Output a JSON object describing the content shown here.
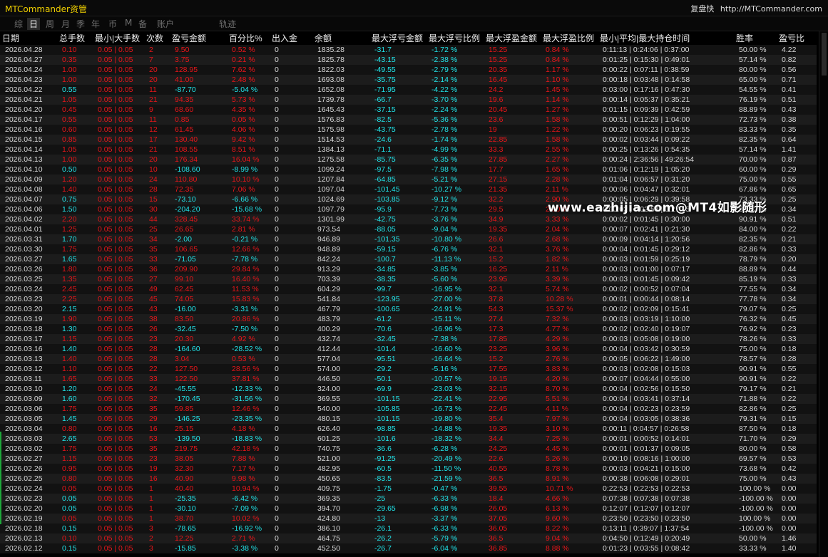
{
  "app": {
    "title": "MTCommander资管",
    "replay_label": "复盘快",
    "url": "http://MTCommander.com"
  },
  "nav": [
    "综",
    "日",
    "周",
    "月",
    "季",
    "年",
    "币",
    "M",
    "备",
    "账户",
    "轨迹"
  ],
  "nav_selected": 1,
  "columns": [
    "日期",
    "总手数",
    "最小|大手数",
    "次数",
    "盈亏金额",
    "百分比%",
    "出入金",
    "余额",
    "最大浮亏金额",
    "最大浮亏比例",
    "最大浮盈金额",
    "最大浮盈比例",
    "最小|平均|最大持仓时间",
    "胜率",
    "盈亏比"
  ],
  "watermark": "www.eazhijia.com@MT4如影随形",
  "rows": [
    [
      "2026.04.28",
      "0.10",
      "0.05 | 0.05",
      "2",
      "9.50",
      "0.52 %",
      "0",
      "1835.28",
      "-31.7",
      "-1.72 %",
      "15.25",
      "0.84 %",
      "0:11:13 | 0:24:06 | 0:37:00",
      "50.00 %",
      "4.22"
    ],
    [
      "2026.04.27",
      "0.35",
      "0.05 | 0.05",
      "7",
      "3.75",
      "0.21 %",
      "0",
      "1825.78",
      "-43.15",
      "-2.38 %",
      "15.25",
      "0.84 %",
      "0:01:25 | 0:15:30 | 0:49:01",
      "57.14 %",
      "0.82"
    ],
    [
      "2026.04.24",
      "1.00",
      "0.05 | 0.05",
      "20",
      "128.95",
      "7.62 %",
      "0",
      "1822.03",
      "-49.55",
      "-2.79 %",
      "20.35",
      "1.17 %",
      "0:00:22 | 0:07:11 | 0:38:59",
      "80.00 %",
      "0.56"
    ],
    [
      "2026.04.23",
      "1.00",
      "0.05 | 0.05",
      "20",
      "41.00",
      "2.48 %",
      "0",
      "1693.08",
      "-35.75",
      "-2.14 %",
      "16.45",
      "1.10 %",
      "0:00:18 | 0:03:48 | 0:14:58",
      "65.00 %",
      "0.71"
    ],
    [
      "2026.04.22",
      "0.55",
      "0.05 | 0.05",
      "11",
      "-87.70",
      "-5.04 %",
      "0",
      "1652.08",
      "-71.95",
      "-4.22 %",
      "24.2",
      "1.45 %",
      "0:03:00 | 0:17:16 | 0:47:30",
      "54.55 %",
      "0.41"
    ],
    [
      "2026.04.21",
      "1.05",
      "0.05 | 0.05",
      "21",
      "94.35",
      "5.73 %",
      "0",
      "1739.78",
      "-66.7",
      "-3.70 %",
      "19.6",
      "1.14 %",
      "0:00:14 | 0:05:37 | 0:35:21",
      "76.19 %",
      "0.51"
    ],
    [
      "2026.04.20",
      "0.45",
      "0.05 | 0.05",
      "9",
      "68.60",
      "4.35 %",
      "0",
      "1645.43",
      "-37.15",
      "-2.24 %",
      "20.45",
      "1.27 %",
      "0:01:15 | 0:09:39 | 0:42:59",
      "88.89 %",
      "0.43"
    ],
    [
      "2026.04.17",
      "0.55",
      "0.05 | 0.05",
      "11",
      "0.85",
      "0.05 %",
      "0",
      "1576.83",
      "-82.5",
      "-5.36 %",
      "23.6",
      "1.58 %",
      "0:00:51 | 0:12:29 | 1:04:00",
      "72.73 %",
      "0.38"
    ],
    [
      "2026.04.16",
      "0.60",
      "0.05 | 0.05",
      "12",
      "61.45",
      "4.06 %",
      "0",
      "1575.98",
      "-43.75",
      "-2.78 %",
      "19",
      "1.22 %",
      "0:00:20 | 0:06:23 | 0:19:55",
      "83.33 %",
      "0.35"
    ],
    [
      "2026.04.15",
      "0.85",
      "0.05 | 0.05",
      "17",
      "130.40",
      "9.42 %",
      "0",
      "1514.53",
      "-24.6",
      "-1.74 %",
      "22.85",
      "1.58 %",
      "0:00:02 | 0:03:44 | 0:09:22",
      "82.35 %",
      "0.64"
    ],
    [
      "2026.04.14",
      "1.05",
      "0.05 | 0.05",
      "21",
      "108.55",
      "8.51 %",
      "0",
      "1384.13",
      "-71.1",
      "-4.99 %",
      "33.3",
      "2.55 %",
      "0:00:25 | 0:13:26 | 0:54:35",
      "57.14 %",
      "1.41"
    ],
    [
      "2026.04.13",
      "1.00",
      "0.05 | 0.05",
      "20",
      "176.34",
      "16.04 %",
      "0",
      "1275.58",
      "-85.75",
      "-6.35 %",
      "27.85",
      "2.27 %",
      "0:00:24 | 2:36:56 | 49:26:54",
      "70.00 %",
      "0.87"
    ],
    [
      "2026.04.10",
      "0.50",
      "0.05 | 0.05",
      "10",
      "-108.60",
      "-8.99 %",
      "0",
      "1099.24",
      "-97.5",
      "-7.98 %",
      "17.7",
      "1.65 %",
      "0:01:06 | 0:12:19 | 1:05:20",
      "60.00 %",
      "0.29"
    ],
    [
      "2026.04.09",
      "1.20",
      "0.05 | 0.05",
      "24",
      "110.80",
      "10.10 %",
      "0",
      "1207.84",
      "-64.85",
      "-5.21 %",
      "27.15",
      "2.28 %",
      "0:01:04 | 0:06:57 | 0:31:20",
      "75.00 %",
      "0.55"
    ],
    [
      "2026.04.08",
      "1.40",
      "0.05 | 0.05",
      "28",
      "72.35",
      "7.06 %",
      "0",
      "1097.04",
      "-101.45",
      "-10.27 %",
      "21.35",
      "2.11 %",
      "0:00:06 | 0:04:47 | 0:32:01",
      "67.86 %",
      "0.65"
    ],
    [
      "2026.04.07",
      "0.75",
      "0.05 | 0.05",
      "15",
      "-73.10",
      "-6.66 %",
      "0",
      "1024.69",
      "-103.85",
      "-9.12 %",
      "32.2",
      "2.90 %",
      "0:00:05 | 0:06:29 | 0:39:58",
      "73.33 %",
      "0.25"
    ],
    [
      "2026.04.06",
      "1.50",
      "0.05 | 0.05",
      "30",
      "-204.20",
      "-15.68 %",
      "0",
      "1097.79",
      "-95.9",
      "-7.73 %",
      "29.5",
      "2.60 %",
      "0:00:02 | 0:02:53 | 0:27:15",
      "83.33 %",
      "0.34"
    ],
    [
      "2026.04.02",
      "2.20",
      "0.05 | 0.05",
      "44",
      "328.45",
      "33.74 %",
      "0",
      "1301.99",
      "-42.75",
      "-3.76 %",
      "34.9",
      "3.33 %",
      "0:00:02 | 0:01:45 | 0:30:00",
      "90.91 %",
      "0.51"
    ],
    [
      "2026.04.01",
      "1.25",
      "0.05 | 0.05",
      "25",
      "26.65",
      "2.81 %",
      "0",
      "973.54",
      "-88.05",
      "-9.04 %",
      "19.35",
      "2.04 %",
      "0:00:07 | 0:02:41 | 0:21:30",
      "84.00 %",
      "0.22"
    ],
    [
      "2026.03.31",
      "1.70",
      "0.05 | 0.05",
      "34",
      "-2.00",
      "-0.21 %",
      "0",
      "946.89",
      "-101.35",
      "-10.80 %",
      "26.6",
      "2.68 %",
      "0:00:09 | 0:04:14 | 1:20:56",
      "82.35 %",
      "0.21"
    ],
    [
      "2026.03.30",
      "1.75",
      "0.05 | 0.05",
      "35",
      "106.65",
      "12.66 %",
      "0",
      "948.89",
      "-59.15",
      "-6.76 %",
      "32.1",
      "3.76 %",
      "0:00:04 | 0:01:45 | 0:29:12",
      "82.86 %",
      "0.33"
    ],
    [
      "2026.03.27",
      "1.65",
      "0.05 | 0.05",
      "33",
      "-71.05",
      "-7.78 %",
      "0",
      "842.24",
      "-100.7",
      "-11.13 %",
      "15.2",
      "1.82 %",
      "0:00:03 | 0:01:59 | 0:25:19",
      "78.79 %",
      "0.20"
    ],
    [
      "2026.03.26",
      "1.80",
      "0.05 | 0.05",
      "36",
      "209.90",
      "29.84 %",
      "0",
      "913.29",
      "-34.85",
      "-3.85 %",
      "16.25",
      "2.11 %",
      "0:00:03 | 0:01:00 | 0:07:17",
      "88.89 %",
      "0.44"
    ],
    [
      "2026.03.25",
      "1.35",
      "0.05 | 0.05",
      "27",
      "99.10",
      "16.40 %",
      "0",
      "703.39",
      "-38.35",
      "-5.60 %",
      "23.95",
      "3.39 %",
      "0:00:03 | 0:01:45 | 0:09:42",
      "85.19 %",
      "0.33"
    ],
    [
      "2026.03.24",
      "2.45",
      "0.05 | 0.05",
      "49",
      "62.45",
      "11.53 %",
      "0",
      "604.29",
      "-99.7",
      "-16.95 %",
      "32.1",
      "5.74 %",
      "0:00:02 | 0:00:52 | 0:07:04",
      "77.55 %",
      "0.34"
    ],
    [
      "2026.03.23",
      "2.25",
      "0.05 | 0.05",
      "45",
      "74.05",
      "15.83 %",
      "0",
      "541.84",
      "-123.95",
      "-27.00 %",
      "37.8",
      "10.28 %",
      "0:00:01 | 0:00:44 | 0:08:14",
      "77.78 %",
      "0.34"
    ],
    [
      "2026.03.20",
      "2.15",
      "0.05 | 0.05",
      "43",
      "-16.00",
      "-3.31 %",
      "0",
      "467.79",
      "-100.65",
      "-24.91 %",
      "54.3",
      "15.37 %",
      "0:00:02 | 0:02:09 | 0:15:41",
      "79.07 %",
      "0.25"
    ],
    [
      "2026.03.19",
      "1.90",
      "0.05 | 0.05",
      "38",
      "83.50",
      "20.86 %",
      "0",
      "483.79",
      "-61.2",
      "-15.11 %",
      "27.4",
      "7.32 %",
      "0:00:03 | 0:03:19 | 1:10:00",
      "76.32 %",
      "0.45"
    ],
    [
      "2026.03.18",
      "1.30",
      "0.05 | 0.05",
      "26",
      "-32.45",
      "-7.50 %",
      "0",
      "400.29",
      "-70.6",
      "-16.96 %",
      "17.3",
      "4.77 %",
      "0:00:02 | 0:02:40 | 0:19:07",
      "76.92 %",
      "0.23"
    ],
    [
      "2026.03.17",
      "1.15",
      "0.05 | 0.05",
      "23",
      "20.30",
      "4.92 %",
      "0",
      "432.74",
      "-32.45",
      "-7.38 %",
      "17.85",
      "4.29 %",
      "0:00:03 | 0:05:08 | 0:19:00",
      "78.26 %",
      "0.33"
    ],
    [
      "2026.03.16",
      "1.40",
      "0.05 | 0.05",
      "28",
      "-164.60",
      "-28.52 %",
      "0",
      "412.44",
      "-101.4",
      "-16.60 %",
      "23.25",
      "3.96 %",
      "0:00:04 | 0:03:42 | 0:30:59",
      "75.00 %",
      "0.18"
    ],
    [
      "2026.03.13",
      "1.40",
      "0.05 | 0.05",
      "28",
      "3.04",
      "0.53 %",
      "0",
      "577.04",
      "-95.51",
      "-16.64 %",
      "15.2",
      "2.76 %",
      "0:00:05 | 0:06:22 | 1:49:00",
      "78.57 %",
      "0.28"
    ],
    [
      "2026.03.12",
      "1.10",
      "0.05 | 0.05",
      "22",
      "127.50",
      "28.56 %",
      "0",
      "574.00",
      "-29.2",
      "-5.16 %",
      "17.55",
      "3.83 %",
      "0:00:03 | 0:02:08 | 0:15:03",
      "90.91 %",
      "0.55"
    ],
    [
      "2026.03.11",
      "1.65",
      "0.05 | 0.05",
      "33",
      "122.50",
      "37.81 %",
      "0",
      "446.50",
      "-50.1",
      "-10.57 %",
      "19.15",
      "4.20 %",
      "0:00:07 | 0:04:44 | 0:55:00",
      "90.91 %",
      "0.22"
    ],
    [
      "2026.03.10",
      "1.20",
      "0.05 | 0.05",
      "24",
      "-45.55",
      "-12.33 %",
      "0",
      "324.00",
      "-69.9",
      "-23.03 %",
      "32.15",
      "8.70 %",
      "0:00:04 | 0:02:56 | 0:15:50",
      "79.17 %",
      "0.21"
    ],
    [
      "2026.03.09",
      "1.60",
      "0.05 | 0.05",
      "32",
      "-170.45",
      "-31.56 %",
      "0",
      "369.55",
      "-101.15",
      "-22.41 %",
      "22.95",
      "5.51 %",
      "0:00:04 | 0:03:41 | 0:37:14",
      "71.88 %",
      "0.22"
    ],
    [
      "2026.03.06",
      "1.75",
      "0.05 | 0.05",
      "35",
      "59.85",
      "12.46 %",
      "0",
      "540.00",
      "-105.85",
      "-16.73 %",
      "22.45",
      "4.11 %",
      "0:00:04 | 0:02:23 | 0:23:59",
      "82.86 %",
      "0.25"
    ],
    [
      "2026.03.05",
      "1.45",
      "0.05 | 0.05",
      "29",
      "-146.25",
      "-23.35 %",
      "0",
      "480.15",
      "-101.15",
      "-19.80 %",
      "35.4",
      "7.97 %",
      "0:00:04 | 0:03:05 | 0:38:36",
      "79.31 %",
      "0.15"
    ],
    [
      "2026.03.04",
      "0.80",
      "0.05 | 0.05",
      "16",
      "25.15",
      "4.18 %",
      "0",
      "626.40",
      "-98.85",
      "-14.88 %",
      "19.35",
      "3.10 %",
      "0:00:11 | 0:04:57 | 0:26:58",
      "87.50 %",
      "0.18"
    ],
    [
      "2026.03.03",
      "2.65",
      "0.05 | 0.05",
      "53",
      "-139.50",
      "-18.83 %",
      "0",
      "601.25",
      "-101.6",
      "-18.32 %",
      "34.4",
      "7.25 %",
      "0:00:01 | 0:00:52 | 0:14:01",
      "71.70 %",
      "0.29"
    ],
    [
      "2026.03.02",
      "1.75",
      "0.05 | 0.05",
      "35",
      "219.75",
      "42.18 %",
      "0",
      "740.75",
      "-36.6",
      "-6.28 %",
      "24.25",
      "4.45 %",
      "0:00:01 | 0:01:37 | 0:09:05",
      "80.00 %",
      "0.58"
    ],
    [
      "2026.02.27",
      "1.15",
      "0.05 | 0.05",
      "23",
      "38.05",
      "7.88 %",
      "0",
      "521.00",
      "-91.25",
      "-20.49 %",
      "22.6",
      "5.26 %",
      "0:00:10 | 0:08:16 | 1:00:00",
      "69.57 %",
      "0.53"
    ],
    [
      "2026.02.26",
      "0.95",
      "0.05 | 0.05",
      "19",
      "32.30",
      "7.17 %",
      "0",
      "482.95",
      "-60.5",
      "-11.50 %",
      "40.55",
      "8.78 %",
      "0:00:03 | 0:04:21 | 0:15:00",
      "73.68 %",
      "0.42"
    ],
    [
      "2026.02.25",
      "0.80",
      "0.05 | 0.05",
      "16",
      "40.90",
      "9.98 %",
      "0",
      "450.65",
      "-83.5",
      "-21.59 %",
      "36.5",
      "8.91 %",
      "0:00:38 | 0:06:08 | 0:29:01",
      "75.00 %",
      "0.43"
    ],
    [
      "2026.02.24",
      "0.05",
      "0.05 | 0.05",
      "1",
      "40.40",
      "10.94 %",
      "0",
      "409.75",
      "-1.75",
      "-0.47 %",
      "39.55",
      "10.71 %",
      "0:22:53 | 0:22:53 | 0:22:53",
      "100.00 %",
      "0.00"
    ],
    [
      "2026.02.23",
      "0.05",
      "0.05 | 0.05",
      "1",
      "-25.35",
      "-6.42 %",
      "0",
      "369.35",
      "-25",
      "-6.33 %",
      "18.4",
      "4.66 %",
      "0:07:38 | 0:07:38 | 0:07:38",
      "-100.00 %",
      "0.00"
    ],
    [
      "2026.02.20",
      "0.05",
      "0.05 | 0.05",
      "1",
      "-30.10",
      "-7.09 %",
      "0",
      "394.70",
      "-29.65",
      "-6.98 %",
      "26.05",
      "6.13 %",
      "0:12:07 | 0:12:07 | 0:12:07",
      "-100.00 %",
      "0.00"
    ],
    [
      "2026.02.19",
      "0.05",
      "0.05 | 0.05",
      "1",
      "38.70",
      "10.02 %",
      "0",
      "424.80",
      "-13",
      "-3.37 %",
      "37.05",
      "9.60 %",
      "0:23:50 | 0:23:50 | 0:23:50",
      "100.00 %",
      "0.00"
    ],
    [
      "2026.02.18",
      "0.15",
      "0.05 | 0.05",
      "3",
      "-78.65",
      "-16.92 %",
      "0",
      "386.10",
      "-26.1",
      "-6.33 %",
      "36.05",
      "8.22 %",
      "0:13:11 | 0:39:07 | 1:37:54",
      "-100.00 %",
      "0.00"
    ],
    [
      "2026.02.13",
      "0.10",
      "0.05 | 0.05",
      "2",
      "12.25",
      "2.71 %",
      "0",
      "464.75",
      "-26.2",
      "-5.79 %",
      "36.5",
      "9.04 %",
      "0:04:50 | 0:12:49 | 0:20:49",
      "50.00 %",
      "1.46"
    ],
    [
      "2026.02.12",
      "0.15",
      "0.05 | 0.05",
      "3",
      "-15.85",
      "-3.38 %",
      "0",
      "452.50",
      "-26.7",
      "-6.04 %",
      "36.85",
      "8.88 %",
      "0:01:23 | 0:03:55 | 0:08:42",
      "33.33 %",
      "1.40"
    ]
  ]
}
